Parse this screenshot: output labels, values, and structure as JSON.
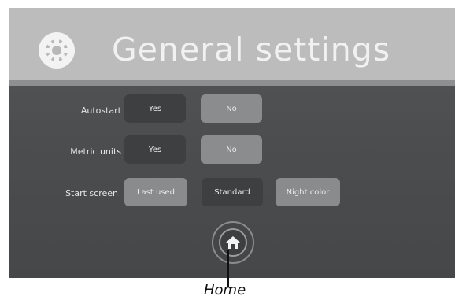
{
  "header": {
    "title": "General settings",
    "icon": "gear-icon"
  },
  "settings": {
    "autostart": {
      "label": "Autostart",
      "options": [
        "Yes",
        "No"
      ]
    },
    "metric_units": {
      "label": "Metric units",
      "options": [
        "Yes",
        "No"
      ]
    },
    "start_screen": {
      "label": "Start screen",
      "options": [
        "Last used",
        "Standard",
        "Night color"
      ]
    }
  },
  "home_button": {
    "icon": "home-icon"
  },
  "annotation": {
    "home_label": "Home"
  },
  "colors": {
    "header_bg": "#bcbcbc",
    "panel_bg": "#4b4d4f",
    "option_dark": "#3d3f41",
    "option_light": "#8b8c8e"
  }
}
